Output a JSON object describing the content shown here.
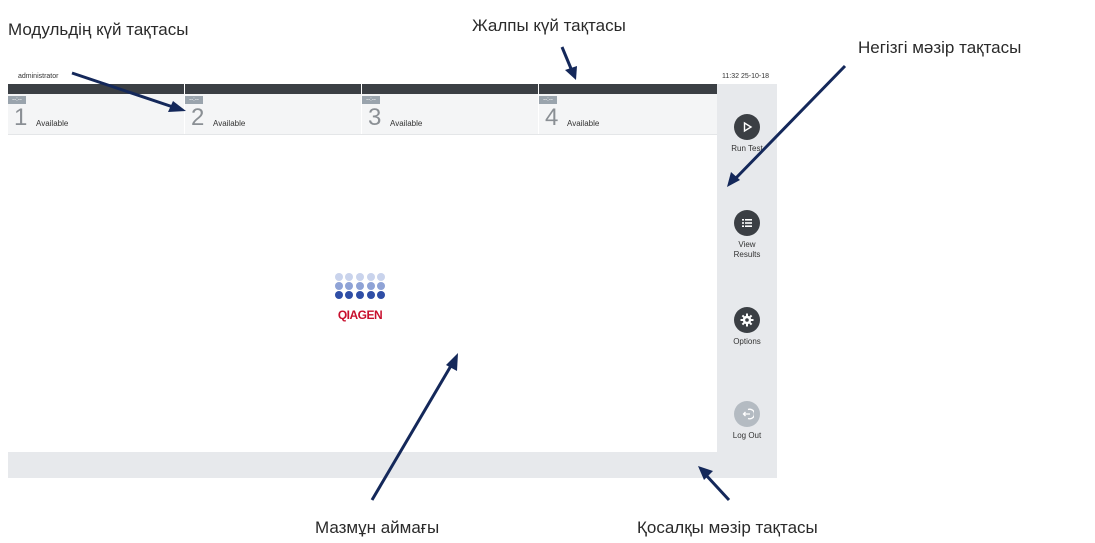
{
  "annotations": {
    "module_status_bar": "Модульдің күй тақтасы",
    "general_status_bar": "Жалпы күй тақтасы",
    "main_menu_bar": "Негізгі мәзір тақтасы",
    "content_area": "Мазмұн аймағы",
    "sub_menu_bar": "Қосалқы мәзір тақтасы"
  },
  "status": {
    "user": "administrator",
    "datetime": "11:32 25-10-18"
  },
  "modules": [
    {
      "badge": "--:--",
      "number": "1",
      "status": "Available"
    },
    {
      "badge": "--:--",
      "number": "2",
      "status": "Available"
    },
    {
      "badge": "--:--",
      "number": "3",
      "status": "Available"
    },
    {
      "badge": "--:--",
      "number": "4",
      "status": "Available"
    }
  ],
  "logo": {
    "text": "QIAGEN"
  },
  "main_menu": [
    {
      "label": "Run Test",
      "icon": "play-icon"
    },
    {
      "label": "View Results",
      "icon": "list-icon"
    },
    {
      "label": "Options",
      "icon": "gear-icon"
    },
    {
      "label": "Log Out",
      "icon": "logout-icon"
    }
  ],
  "colors": {
    "accent_dark": "#3b3f44",
    "qiagen_red": "#c8102e",
    "arrow": "#14285a"
  }
}
